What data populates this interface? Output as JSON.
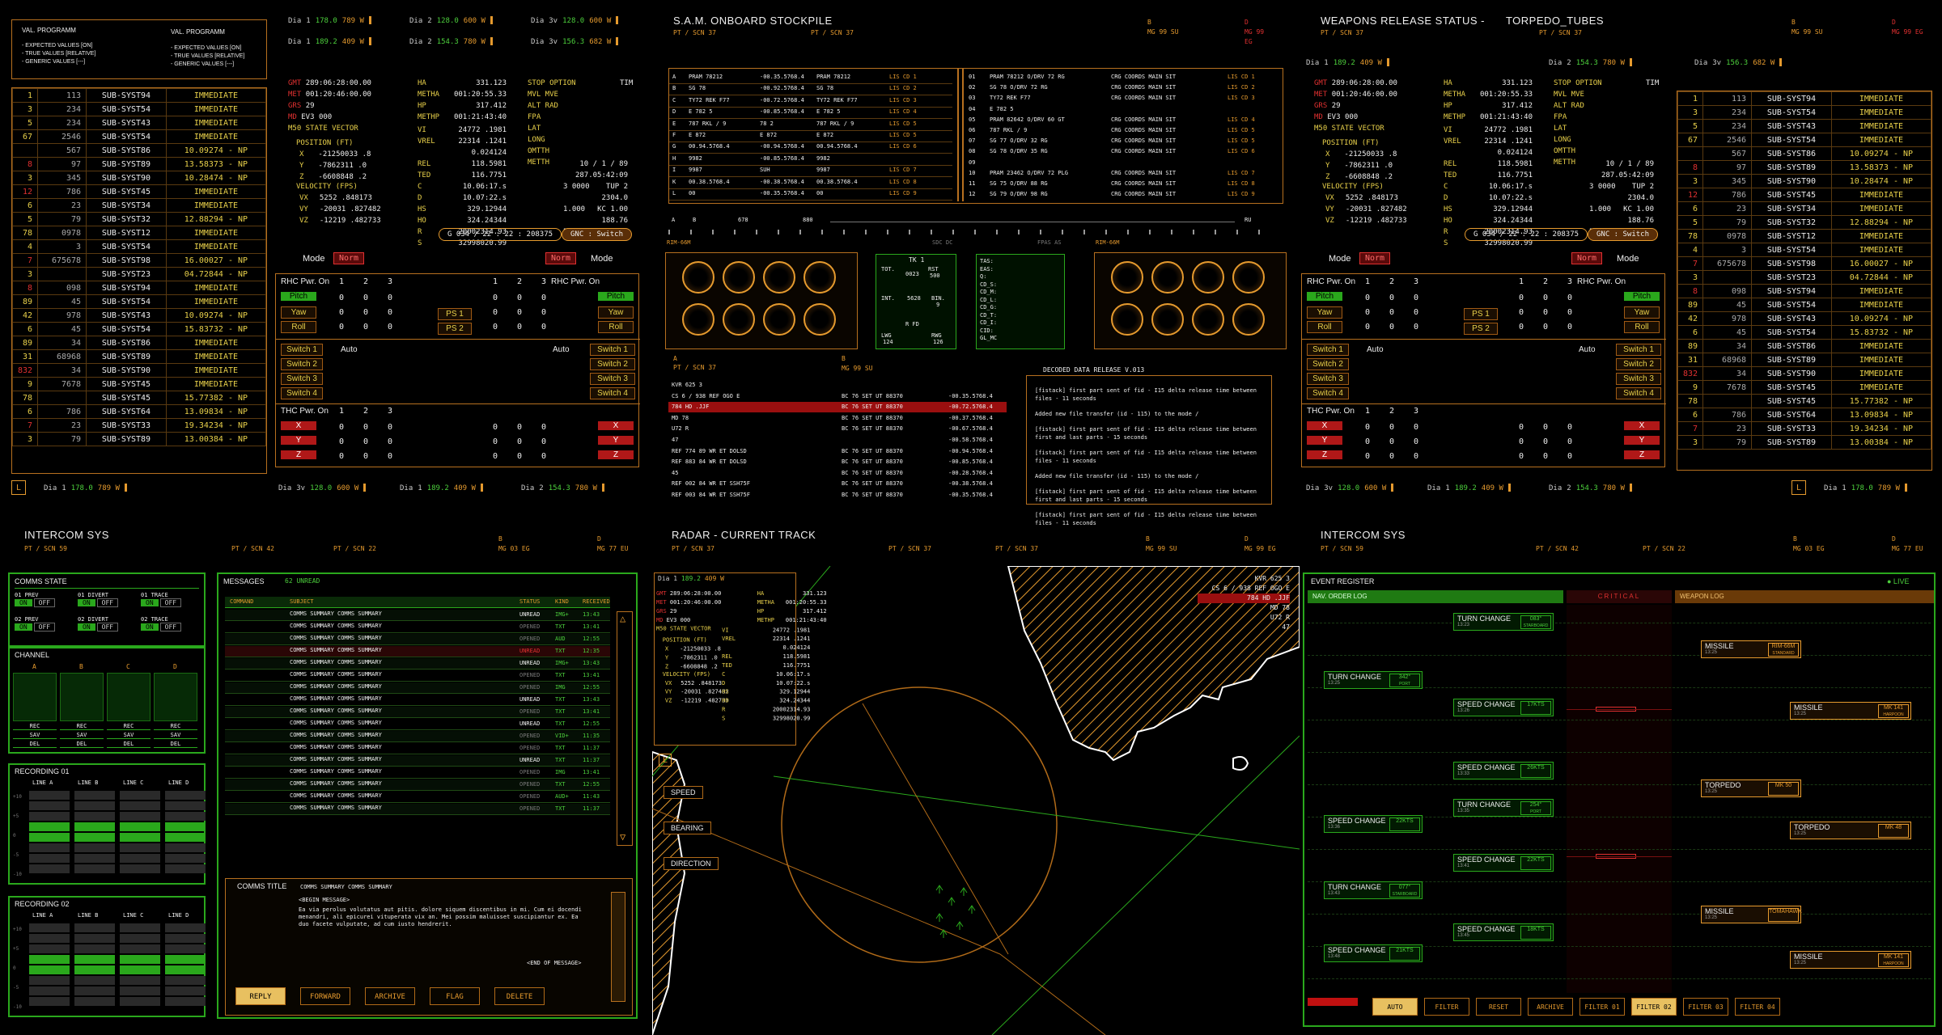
{
  "top_gauges": {
    "g1": {
      "label": "Dia",
      "v1": "1",
      "v2": "178.0",
      "v3": "789",
      "u": "W"
    },
    "g2": {
      "label": "Dia",
      "v1": "2",
      "v2": "128.0",
      "v3": "600",
      "u": "W"
    },
    "g3": {
      "label": "Dia",
      "v1": "3v",
      "v2": "128.0",
      "v3": "600",
      "u": "W"
    },
    "g4": {
      "label": "Dia",
      "v1": "1",
      "v2": "189.2",
      "v3": "409",
      "u": "W"
    },
    "g5": {
      "label": "Dia",
      "v1": "2",
      "v2": "154.3",
      "v3": "780",
      "u": "W"
    },
    "g6": {
      "label": "Dia",
      "v1": "3v",
      "v2": "156.3",
      "v3": "682",
      "u": "W"
    }
  },
  "val_legend": {
    "h1": "VAL. PROGRAMM",
    "h2": "VAL. PROGRAMM",
    "l1": "- EXPECTED VALUES [ON]",
    "l2": "- TRUE VALUES [RELATIVE]",
    "l3": "- GENERIC VALUES [---]"
  },
  "subsys": [
    [
      "1",
      "113",
      "SUB-SYST94",
      "IMMEDIATE"
    ],
    [
      "3",
      "234",
      "SUB-SYST54",
      "IMMEDIATE"
    ],
    [
      "5",
      "234",
      "SUB-SYST43",
      "IMMEDIATE"
    ],
    [
      "67",
      "2546",
      "SUB-SYST54",
      "IMMEDIATE"
    ],
    [
      "",
      "567",
      "SUB-SYST86",
      "10.09274 - NP"
    ],
    [
      "8",
      "97",
      "SUB-SYST89",
      "13.58373 - NP"
    ],
    [
      "3",
      "345",
      "SUB-SYST90",
      "10.28474 - NP"
    ],
    [
      "12",
      "786",
      "SUB-SYST45",
      "IMMEDIATE"
    ],
    [
      "6",
      "23",
      "SUB-SYST34",
      "IMMEDIATE"
    ],
    [
      "5",
      "79",
      "SUB-SYST32",
      "12.88294 - NP"
    ],
    [
      "78",
      "0978",
      "SUB-SYST12",
      "IMMEDIATE"
    ],
    [
      "4",
      "3",
      "SUB-SYST54",
      "IMMEDIATE"
    ],
    [
      "7",
      "675678",
      "SUB-SYST98",
      "16.00027 - NP"
    ],
    [
      "3",
      "",
      "SUB-SYST23",
      "04.72844 - NP"
    ],
    [
      "8",
      "098",
      "SUB-SYST94",
      "IMMEDIATE"
    ],
    [
      "89",
      "45",
      "SUB-SYST54",
      "IMMEDIATE"
    ],
    [
      "42",
      "978",
      "SUB-SYST43",
      "10.09274 - NP"
    ],
    [
      "6",
      "45",
      "SUB-SYST54",
      "15.83732 - NP"
    ],
    [
      "89",
      "34",
      "SUB-SYST86",
      "IMMEDIATE"
    ],
    [
      "31",
      "68968",
      "SUB-SYST89",
      "IMMEDIATE"
    ],
    [
      "832",
      "34",
      "SUB-SYST90",
      "IMMEDIATE"
    ],
    [
      "9",
      "7678",
      "SUB-SYST45",
      "IMMEDIATE"
    ],
    [
      "78",
      "",
      "SUB-SYST45",
      "15.77382 - NP"
    ],
    [
      "6",
      "786",
      "SUB-SYST64",
      "13.09834 - NP"
    ],
    [
      "7",
      "23",
      "SUB-SYST33",
      "19.34234 - NP"
    ],
    [
      "3",
      "79",
      "SUB-SYST89",
      "13.00384 - NP"
    ]
  ],
  "state": {
    "lines": [
      [
        "GMT",
        "289:06:28:00.00"
      ],
      [
        "MET",
        "001:20:46:00.00"
      ],
      [
        "GRS",
        "29"
      ],
      [
        "MD",
        "EV3 000"
      ]
    ],
    "ha": [
      [
        "HA",
        "331.123"
      ],
      [
        "METHA",
        "001:20:55.33"
      ],
      [
        "HP",
        "317.412"
      ],
      [
        "METHP",
        "001:21:43:40"
      ]
    ],
    "stop": [
      "STOP OPTION",
      "MVL MVE",
      "ALT RAD",
      "FPA",
      "LAT",
      "LONG",
      "OMTTH",
      "METTH"
    ],
    "tim": "TIM",
    "vec_title": "M50 STATE VECTOR",
    "pos_title": "POSITION (FT)",
    "vel_title": "VELOCITY (FPS)",
    "pos": [
      [
        "X",
        "-21250033 .8"
      ],
      [
        "Y",
        "-7862311 .0"
      ],
      [
        "Z",
        "-6608848 .2"
      ]
    ],
    "vel": [
      [
        "VX",
        "5252 .848173"
      ],
      [
        "VY",
        "-20031 .827482"
      ],
      [
        "VZ",
        "-12219 .482733"
      ]
    ],
    "mid": [
      [
        "VI",
        "24772 .1981"
      ],
      [
        "VREL",
        "22314 .1241"
      ],
      [
        "",
        "0.024124"
      ],
      [
        "REL",
        "118.5981"
      ],
      [
        "TED",
        "116.7751"
      ],
      [
        "C",
        "10.06:17.s"
      ],
      [
        "D",
        "10.07:22.s"
      ],
      [
        "HS",
        "329.12944"
      ],
      [
        "HO",
        "324.24344"
      ],
      [
        "R",
        "20002314.93"
      ],
      [
        "S",
        "32998020.99"
      ]
    ],
    "right": [
      [
        "",
        "10 / 1 / 89"
      ],
      [
        "",
        "287.05:42:09"
      ],
      [
        "3 0000",
        "TUP 2"
      ],
      [
        "",
        "2304.0"
      ],
      [
        "1.000",
        "KC 1.00"
      ],
      [
        "",
        "188.76"
      ],
      [
        "EPH",
        "DM"
      ]
    ],
    "clock": "G 034 / 22 : 22 : 208375",
    "gnc": "GNC : Switch"
  },
  "rhc": {
    "mode": "Mode",
    "norm": "Norm",
    "title": "RHC Pwr. On",
    "cols": [
      "1",
      "2",
      "3"
    ],
    "rows": [
      "Pitch",
      "Yaw",
      "Roll"
    ],
    "ps": [
      "PS 1",
      "PS 2"
    ],
    "switches": [
      "Switch 1",
      "Switch 2",
      "Switch 3",
      "Switch 4"
    ],
    "auto": "Auto",
    "thc": "THC Pwr. On",
    "thc_rows": [
      "X",
      "Y",
      "Z"
    ],
    "zero": "0"
  },
  "bottom_gauges": {
    "l": "L",
    "a": [
      "Dia",
      "1",
      "178.0",
      "789"
    ],
    "b": [
      "Dia",
      "3v",
      "128.0",
      "600"
    ],
    "c": [
      "Dia",
      "1",
      "189.2",
      "409"
    ],
    "d": [
      "Dia",
      "2",
      "154.3",
      "780"
    ]
  },
  "headers": {
    "sam": {
      "title": "S.A.M. ONBOARD STOCKPILE",
      "s1": "PT / SCN 37",
      "s2": "PT / SCN 37",
      "s3": "B",
      "s4": "MG 99 SU",
      "s5": "D",
      "s6": "MG 99 EG"
    },
    "weapons": {
      "title": "WEAPONS RELEASE STATUS  -",
      "t2": "TORPEDO_TUBES",
      "s1": "PT / SCN 37",
      "s2": "PT / SCN 37",
      "s3": "B",
      "s4": "MG 99 SU",
      "s5": "D",
      "s6": "MG 99 EG"
    },
    "intercom1": {
      "title": "INTERCOM SYS",
      "s1": "PT / SCN 59",
      "s2": "PT / SCN 42",
      "s3": "PT / SCN 22",
      "s4": "B",
      "s5": "MG 03 EG",
      "s6": "D",
      "s7": "MG 77 EU"
    },
    "radar": {
      "title": "RADAR - CURRENT TRACK",
      "s1": "PT / SCN 37",
      "s2": "PT / SCN 37",
      "s3": "PT / SCN 37",
      "s4": "B",
      "s5": "MG 99 SU",
      "s6": "D",
      "s7": "MG 99 EG"
    },
    "intercom2": {
      "title": "INTERCOM SYS",
      "s1": "PT / SCN 59",
      "s2": "PT / SCN 42",
      "s3": "PT / SCN 22",
      "s4": "B",
      "s5": "MG 03 EG",
      "s6": "D",
      "s7": "MG 77 EU"
    }
  },
  "stock": {
    "left": [
      [
        "A",
        "PRAM 78212",
        "-00.35.5768.4",
        "PRAM 78212",
        "LIS CD 1"
      ],
      [
        "B",
        "SG 78",
        "-00.92.5768.4",
        "SG 78",
        "LIS CD 2"
      ],
      [
        "C",
        "TY72 REK F77",
        "-00.72.5768.4",
        "TY72 REK F77",
        "LIS CD 3"
      ],
      [
        "D",
        "E 782 5",
        "-00.85.5768.4",
        "E 782 5",
        "LIS CD 4"
      ],
      [
        "E",
        "787 RKL / 9",
        "78 2",
        "787 RKL / 9",
        "LIS CD 5"
      ],
      [
        "F",
        "E 872",
        "E 872",
        "E 872",
        "LIS CD 5"
      ],
      [
        "G",
        "00.94.5768.4",
        "-00.94.5768.4",
        "00.94.5768.4",
        "LIS CD 6"
      ],
      [
        "H",
        "9982",
        "-00.85.5768.4",
        "9982",
        ""
      ],
      [
        "I",
        "9987",
        "SUH",
        "9987",
        "LIS CD 7"
      ],
      [
        "K",
        "00.38.5768.4",
        "-00.38.5768.4",
        "00.38.5768.4",
        "LIS CD 8"
      ],
      [
        "L",
        "00",
        "-00.35.5768.4",
        "00",
        "LIS CD 9"
      ]
    ],
    "right": [
      [
        "01",
        "PRAM 78212 O/DRV 72 RG",
        "CRG COORDS MAIN SIT",
        "LIS CD 1"
      ],
      [
        "02",
        "SG 78 O/DRV 72 RG",
        "CRG COORDS MAIN SIT",
        "LIS CD 2"
      ],
      [
        "03",
        "TY72 REK F77",
        "CRG COORDS MAIN SIT",
        "LIS CD 3"
      ],
      [
        "04",
        "E 782 5",
        "",
        ""
      ],
      [
        "05",
        "PRAM 82642 O/DRV 60 GT",
        "CRG COORDS MAIN SIT",
        "LIS CD 4"
      ],
      [
        "06",
        "787 RKL / 9",
        "CRG COORDS MAIN SIT",
        "LIS CD 5"
      ],
      [
        "07",
        "SG 77 O/DRV 32 RG",
        "CRG COORDS MAIN SIT",
        "LIS CD 5"
      ],
      [
        "08",
        "SG 78 O/DRV 35 RG",
        "CRG COORDS MAIN SIT",
        "LIS CD 6"
      ],
      [
        "09",
        "",
        "",
        " "
      ],
      [
        "10",
        "PRAM 23462 O/DRV 72 PLG",
        "CRG COORDS MAIN SIT",
        "LIS CD 7"
      ],
      [
        "11",
        "SG 75 O/DRV 88 RG",
        "CRG COORDS MAIN SIT",
        "LIS CD 8"
      ],
      [
        "12",
        "SG 79 O/DRV 98 RG",
        "CRG COORDS MAIN SIT",
        "LIS CD 9"
      ]
    ],
    "scale": [
      "A",
      "B",
      "678",
      "880",
      "RU"
    ],
    "rim": "RIM-66M",
    "tk": "TK 1",
    "tot": "TOT.",
    "tot_v": "0023",
    "rst": "RST",
    "rst_v": "500",
    "int": "INT.",
    "int_v": "5628",
    "bin": "BIN.",
    "bin_v": "9",
    "rfd": "R FD",
    "lwg": "LWG",
    "lwg_v": "124",
    "rwg": "RWG",
    "rwg_v": "126",
    "sdc": "SDC DC",
    "fpas": "FPAS AS",
    "tas": [
      "TAS:",
      "EAS:",
      "Q:",
      "CD_S:",
      "CD_M:",
      "CD_L:",
      "CD_G:",
      "CD_T:",
      "CD_I:",
      "CID:",
      "GL_MC"
    ]
  },
  "decoded": {
    "h1": "PT / SCN 37",
    "h2": "MG 99 SU",
    "title": "DECODED DATA RELEASE V.013",
    "rows": [
      [
        "KVR 625 3",
        "",
        ""
      ],
      [
        "CS 6 / 938 REF OGO E",
        "BC 76 SET UT 88370",
        "-00.35.5768.4"
      ],
      [
        "784 HD .JJF",
        "BC 76 SET UT 88370",
        "-00.72.5768.4"
      ],
      [
        "MD 78",
        "BC 76 SET UT 88370",
        "-00.37.5768.4"
      ],
      [
        "U72 R",
        "BC 76 SET UT 88370",
        "-00.67.5768.4"
      ],
      [
        "47",
        "",
        "-00.58.5768.4"
      ],
      [
        "REF 774 89 WR ET DOLSD",
        "BC 76 SET UT 88370",
        "-00.94.5768.4"
      ],
      [
        "REF 883 84 WR ET DOLSD",
        "BC 76 SET UT 88370",
        "-00.85.5768.4"
      ],
      [
        "45",
        "BC 76 SET UT 88370",
        "-00.28.5768.4"
      ],
      [
        "REF 002 84 WR ET SSH75F",
        "BC 76 SET UT 88370",
        "-00.38.5768.4"
      ],
      [
        "REF 003 84 WR ET SSH75F",
        "BC 76 SET UT 88370",
        "-00.35.5768.4"
      ]
    ],
    "log": [
      "[fistack] first part sent of fid - I15 delta release time between files - 11 seconds",
      "Added new file transfer (id - 115) to the mode /",
      "[fistack] first part sent of fid - I15 delta release time between first and last parts - 15 seconds",
      "[fistack] first part sent of fid - I15 delta release time between files - 11 seconds",
      "Added new file transfer (id - 115) to the mode /",
      "[fistack] first part sent of fid - I15 delta release time between first and last parts - 15 seconds",
      "[fistack] first part sent of fid - I15 delta release time between files - 11 seconds"
    ]
  },
  "comms": {
    "state_title": "COMMS STATE",
    "cells": [
      [
        "01 PREV",
        "ON",
        "OFF"
      ],
      [
        "01 DIVERT",
        "ON",
        "OFF"
      ],
      [
        "01 TRACE",
        "ON",
        "OFF"
      ],
      [
        "02 PREV",
        "ON",
        "OFF"
      ],
      [
        "02 DIVERT",
        "ON",
        "OFF"
      ],
      [
        "02 TRACE",
        "ON",
        "OFF"
      ]
    ],
    "channel": "CHANNEL",
    "ch_cols": [
      "A",
      "B",
      "C",
      "D"
    ],
    "ch_btns": [
      "REC",
      "SAV",
      "DEL"
    ],
    "rec1": "RECORDING 01",
    "rec2": "RECORDING 02",
    "lines": [
      "LINE A",
      "LINE B",
      "LINE C",
      "LINE D"
    ],
    "messages": "MESSAGES",
    "unread": "62 UNREAD",
    "cols": [
      "COMMAND",
      "SUBJECT",
      "STATUS",
      "KIND",
      "RECEIVED"
    ],
    "subj": "COMMS SUMMARY COMMS SUMMARY",
    "rows": [
      [
        "UNREAD",
        "IMG+",
        "13:43"
      ],
      [
        "OPENED",
        "TXT",
        "13:41"
      ],
      [
        "OPENED",
        "AUD",
        "12:55"
      ],
      [
        "UNREAD",
        "TXT",
        "12:35"
      ],
      [
        "UNREAD",
        "IMG+",
        "13:43"
      ],
      [
        "OPENED",
        "TXT",
        "13:41"
      ],
      [
        "OPENED",
        "IMG",
        "12:55"
      ],
      [
        "UNREAD",
        "TXT",
        "13:43"
      ],
      [
        "OPENED",
        "TXT",
        "13:41"
      ],
      [
        "UNREAD",
        "TXT",
        "12:55"
      ],
      [
        "OPENED",
        "VID+",
        "11:35"
      ],
      [
        "OPENED",
        "TXT",
        "11:37"
      ],
      [
        "UNREAD",
        "TXT",
        "11:37"
      ],
      [
        "OPENED",
        "IMG",
        "13:41"
      ],
      [
        "OPENED",
        "TXT",
        "12:55"
      ],
      [
        "OPENED",
        "AUD+",
        "11:43"
      ],
      [
        "OPENED",
        "TXT",
        "11:37"
      ]
    ],
    "detail_title": "COMMS TITLE",
    "detail_sub": "COMMS SUMMARY COMMS SUMMARY",
    "begin": "<BEGIN MESSAGE>",
    "end": "<END OF MESSAGE>",
    "body": "Ea via perolus volutatus aut pitis. dolore siquem discentibus in mi. Cum ei docendi menandri, ali epicurei vituperata vix an. Mei possim maluisset suscipiantur ex. Ea duo facete vulputate, ad cum iusto hendrerit.",
    "actions": [
      "REPLY",
      "FORWARD",
      "ARCHIVE",
      "FLAG",
      "DELETE"
    ]
  },
  "radar": {
    "speed": "SPEED",
    "bearing": "BEARING",
    "direction": "DIRECTION",
    "tags": [
      "KVR 625 3",
      "CS 6 / 938 REF OGO E",
      "784 HD .JJF",
      "MD 78",
      "U72 R",
      "47"
    ]
  },
  "events": {
    "title": "EVENT REGISTER",
    "live": "LIVE",
    "nav": "NAV. ORDER LOG",
    "critical": "CRITICAL",
    "weapon": "WEAPON LOG",
    "nav_items": [
      [
        "TURN CHANGE",
        "13:25",
        "342°",
        "PORT"
      ],
      [
        "SPEED CHANGE",
        "13:36",
        "22KTS",
        ""
      ],
      [
        "TURN CHANGE",
        "13:43",
        "077°",
        "STARBOARD"
      ],
      [
        "SPEED CHANGE",
        "13:48",
        "21KTS",
        ""
      ]
    ],
    "nav_items2": [
      [
        "TURN CHANGE",
        "13:23",
        "083°",
        "STARBOARD"
      ],
      [
        "SPEED CHANGE",
        "13:26",
        "17KTS",
        ""
      ],
      [
        "SPEED CHANGE",
        "13:33",
        "26KTS",
        ""
      ],
      [
        "TURN CHANGE",
        "13:35",
        "254°",
        "PORT"
      ],
      [
        "SPEED CHANGE",
        "13:41",
        "22KTS",
        ""
      ],
      [
        "SPEED CHANGE",
        "13:45",
        "18KTS",
        ""
      ]
    ],
    "weapons": [
      [
        "MISSILE",
        "13:25",
        "RIM-66M",
        "STANDARD"
      ],
      [
        "MISSILE",
        "13:25",
        "MK 141",
        "HARPOON"
      ],
      [
        "TORPEDO",
        "13:25",
        "MK 50",
        ""
      ],
      [
        "TORPEDO",
        "13:25",
        "MK 48",
        ""
      ],
      [
        "MISSILE",
        "13:25",
        "TOMAHAWK",
        ""
      ],
      [
        "MISSILE",
        "13:25",
        "MK 141",
        "HARPOON"
      ]
    ],
    "filters": [
      "AUTO",
      "FILTER",
      "RESET",
      "ARCHIVE",
      "FILTER 01",
      "FILTER 02",
      "FILTER 03",
      "FILTER 04"
    ]
  }
}
